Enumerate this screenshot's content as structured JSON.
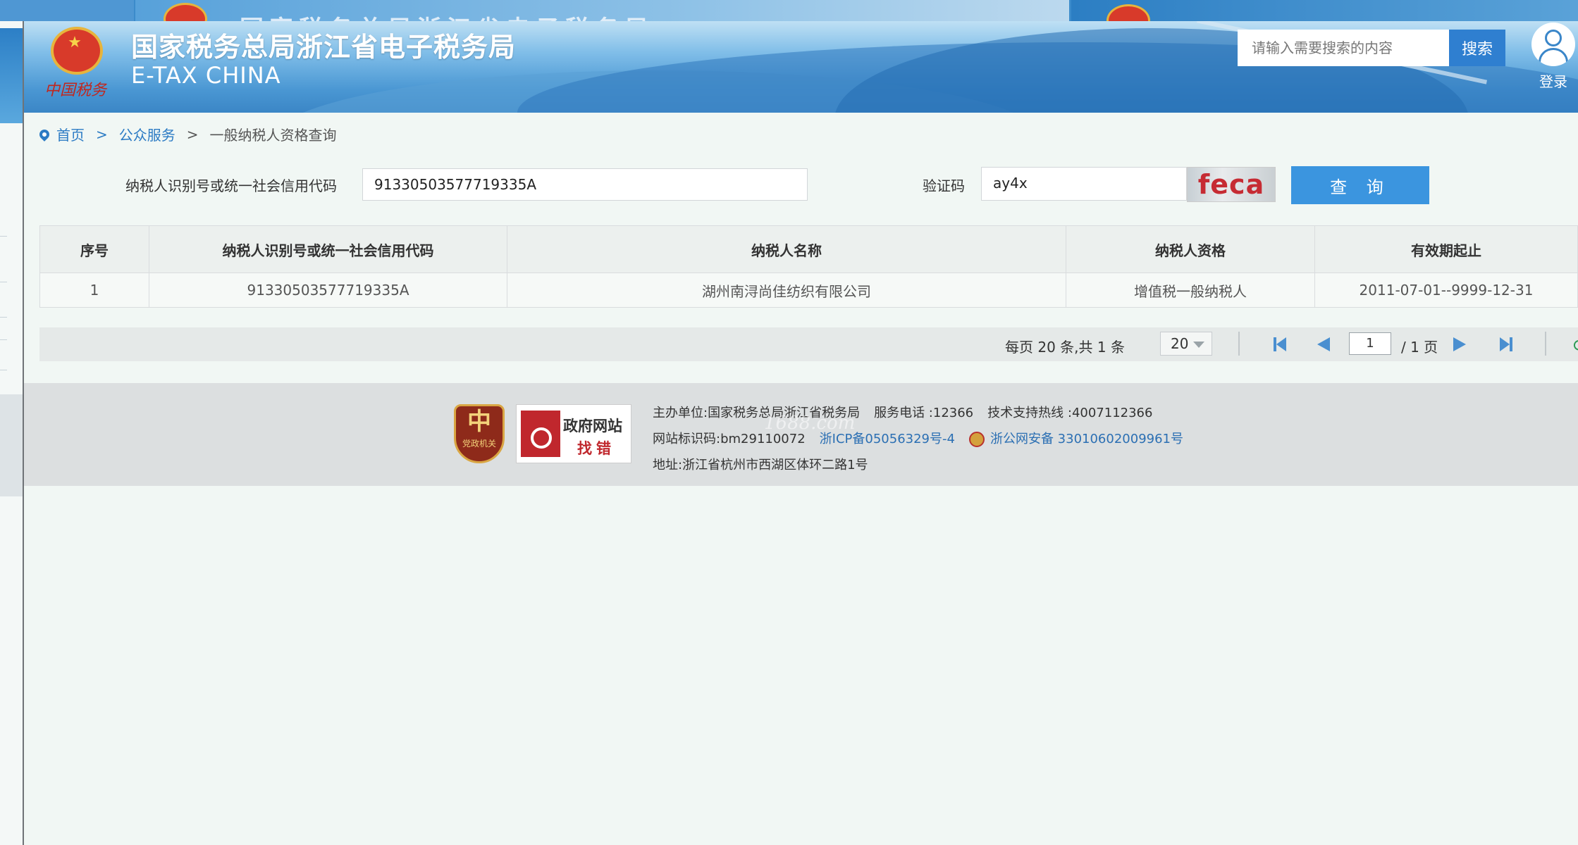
{
  "header": {
    "title": "国家税务总局浙江省电子税务局",
    "subtitle": "E-TAX CHINA",
    "brand": "中国税务",
    "search_placeholder": "请输入需要搜索的内容",
    "search_button": "搜索",
    "login_label": "登录"
  },
  "breadcrumb": {
    "home": "首页",
    "sep": ">",
    "section": "公众服务",
    "current": "一般纳税人资格查询"
  },
  "form": {
    "taxpayer_label": "纳税人识别号或统一社会信用代码",
    "taxpayer_value": "91330503577719335A",
    "captcha_label": "验证码",
    "captcha_value": "ay4x",
    "captcha_image_text": "feca",
    "query_button": "查 询"
  },
  "table": {
    "columns": [
      "序号",
      "纳税人识别号或统一社会信用代码",
      "纳税人名称",
      "纳税人资格",
      "有效期起止"
    ],
    "rows": [
      [
        "1",
        "91330503577719335A",
        "湖州南浔尚佳纺织有限公司",
        "增值税一般纳税人",
        "2011-07-01--9999-12-31"
      ]
    ]
  },
  "pager": {
    "summary": "每页 20 条,共 1 条",
    "page_size": "20",
    "current_page": "1",
    "total_pages": "/ 1 页"
  },
  "footer": {
    "badge1_text": "党政机关",
    "badge2_line1": "政府网站",
    "badge2_line2": "找错",
    "host_label": "主办单位:",
    "host": "国家税务总局浙江省税务局",
    "phone_label": "服务电话 :",
    "phone": "12366",
    "support_label": "技术支持热线 :",
    "support": "4007112366",
    "site_id_label": "网站标识码:",
    "site_id": "bm29110072",
    "icp": "浙ICP备05056329号-4",
    "police": "浙公网安备 33010602009961号",
    "address_label": "地址:",
    "address": "浙江省杭州市西湖区体环二路1号",
    "watermark": "1688.com"
  },
  "colors": {
    "accent": "#3b95df",
    "link": "#2c7bc4",
    "captcha_red": "#c62b33"
  }
}
